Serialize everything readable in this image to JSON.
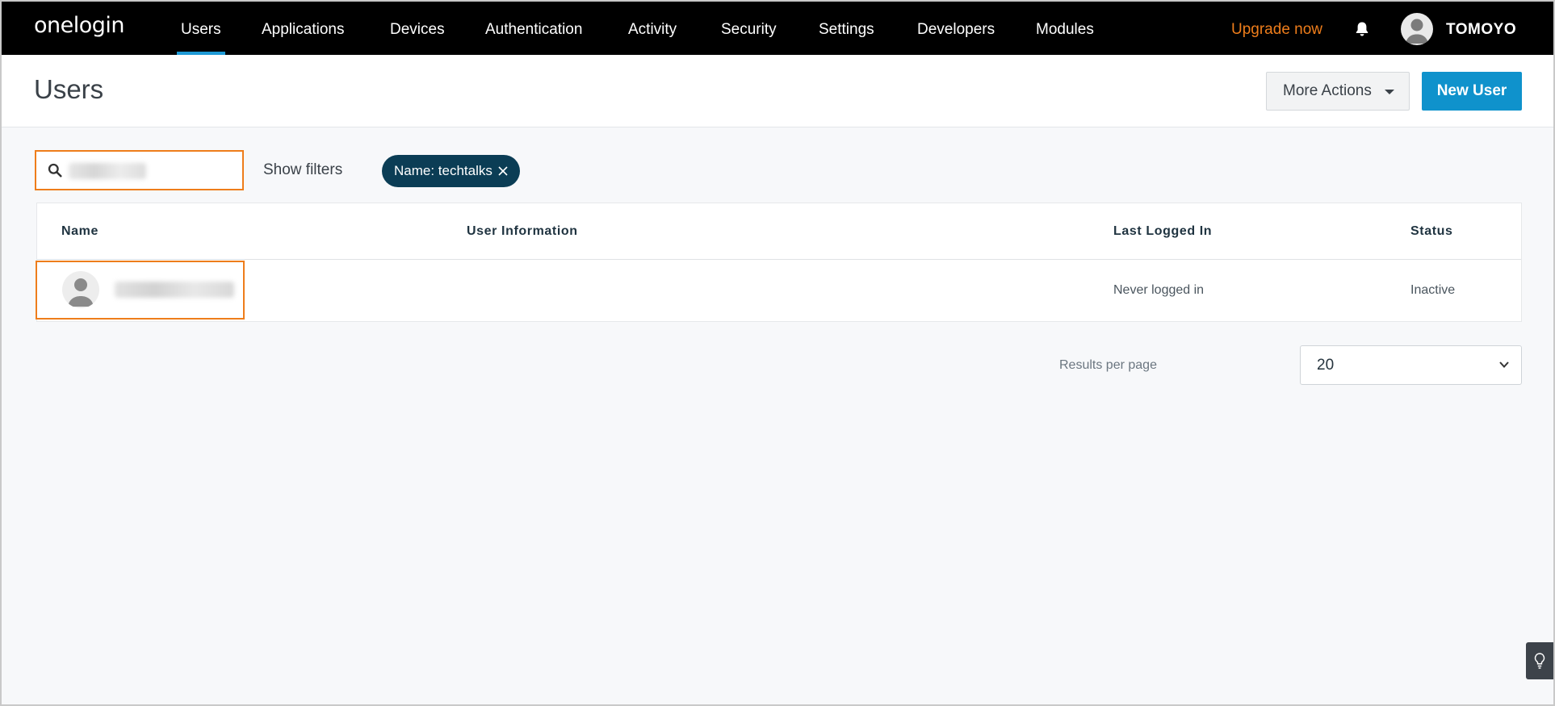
{
  "app": {
    "logo": "onelogin",
    "nav": [
      {
        "label": "Users",
        "active": true
      },
      {
        "label": "Applications"
      },
      {
        "label": "Devices"
      },
      {
        "label": "Authentication"
      },
      {
        "label": "Activity"
      },
      {
        "label": "Security"
      },
      {
        "label": "Settings"
      },
      {
        "label": "Developers"
      },
      {
        "label": "Modules"
      }
    ],
    "upgrade_label": "Upgrade now",
    "username": "TOMOYO",
    "icons": {
      "bell": "bell-icon",
      "avatar": "user-avatar-icon"
    }
  },
  "header": {
    "title": "Users",
    "more_actions_label": "More Actions",
    "new_user_label": "New User"
  },
  "filters": {
    "search_value": "",
    "show_filters_label": "Show filters",
    "chip_label": "Name: techtalks"
  },
  "table": {
    "columns": [
      "Name",
      "User Information",
      "Last Logged In",
      "Status"
    ],
    "rows": [
      {
        "name": "",
        "user_information": "",
        "last_logged_in": "Never logged in",
        "status": "Inactive"
      }
    ]
  },
  "pagination": {
    "results_per_page_label": "Results per page",
    "selected": "20"
  },
  "colors": {
    "nav_bg": "#000000",
    "accent_blue": "#0f92cc",
    "upgrade_orange": "#ee7d1b",
    "chip_bg": "#0b3d55",
    "highlight_orange": "#ee7d1b"
  }
}
